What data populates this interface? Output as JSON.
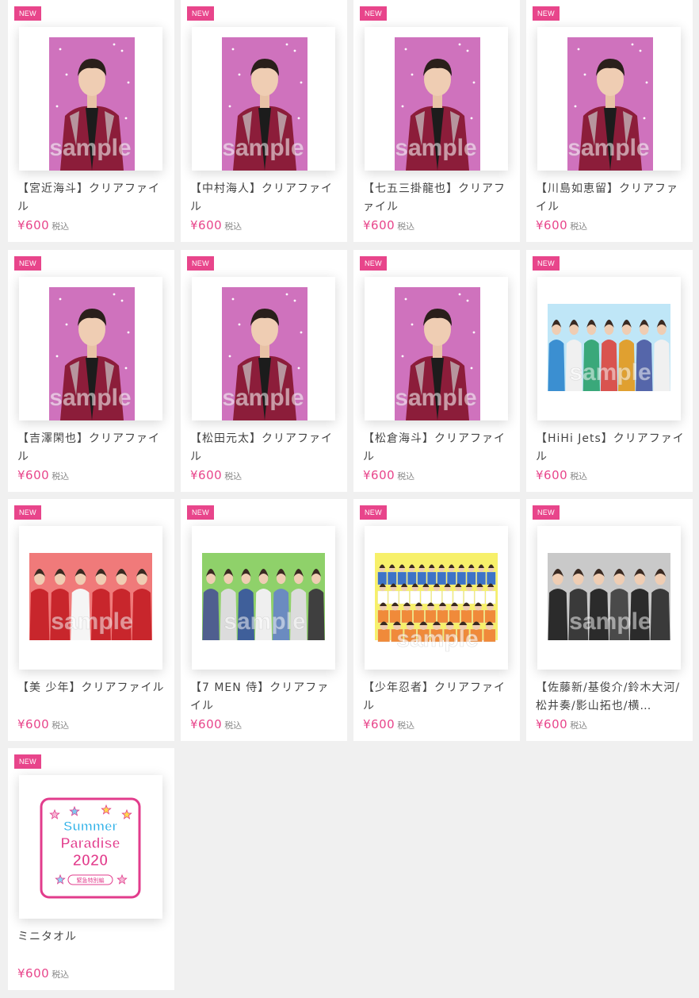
{
  "colors": {
    "accent": "#e8458b",
    "background": "#f0f0f0",
    "card": "#ffffff"
  },
  "products": [
    {
      "badge": "NEW",
      "title": "【宮近海斗】クリアファイル",
      "price": "¥600",
      "tax": "税込",
      "thumb": "solo"
    },
    {
      "badge": "NEW",
      "title": "【中村海人】クリアファイル",
      "price": "¥600",
      "tax": "税込",
      "thumb": "solo"
    },
    {
      "badge": "NEW",
      "title": "【七五三掛龍也】クリアファイル",
      "price": "¥600",
      "tax": "税込",
      "thumb": "solo"
    },
    {
      "badge": "NEW",
      "title": "【川島如恵留】クリアファイル",
      "price": "¥600",
      "tax": "税込",
      "thumb": "solo"
    },
    {
      "badge": "NEW",
      "title": "【吉澤閑也】クリアファイル",
      "price": "¥600",
      "tax": "税込",
      "thumb": "solo"
    },
    {
      "badge": "NEW",
      "title": "【松田元太】クリアファイル",
      "price": "¥600",
      "tax": "税込",
      "thumb": "solo"
    },
    {
      "badge": "NEW",
      "title": "【松倉海斗】クリアファイル",
      "price": "¥600",
      "tax": "税込",
      "thumb": "solo"
    },
    {
      "badge": "NEW",
      "title": "【HiHi Jets】クリアファイル",
      "price": "¥600",
      "tax": "税込",
      "thumb": "group-blue"
    },
    {
      "badge": "NEW",
      "title": "【美 少年】クリアファイル",
      "price": "¥600",
      "tax": "税込",
      "thumb": "group-red"
    },
    {
      "badge": "NEW",
      "title": "【7 MEN 侍】クリアファイル",
      "price": "¥600",
      "tax": "税込",
      "thumb": "group-green"
    },
    {
      "badge": "NEW",
      "title": "【少年忍者】クリアファイル",
      "price": "¥600",
      "tax": "税込",
      "thumb": "group-yellow"
    },
    {
      "badge": "NEW",
      "title": "【佐藤新/基俊介/鈴木大河/松井奏/影山拓也/横…",
      "price": "¥600",
      "tax": "税込",
      "thumb": "group-gray"
    },
    {
      "badge": "NEW",
      "title": "ミニタオル",
      "price": "¥600",
      "tax": "税込",
      "thumb": "towel"
    }
  ],
  "watermark": "sample",
  "towel": {
    "line1": "Summer",
    "line2": "Paradise",
    "line3": "2020",
    "sub": "緊急特別編"
  }
}
